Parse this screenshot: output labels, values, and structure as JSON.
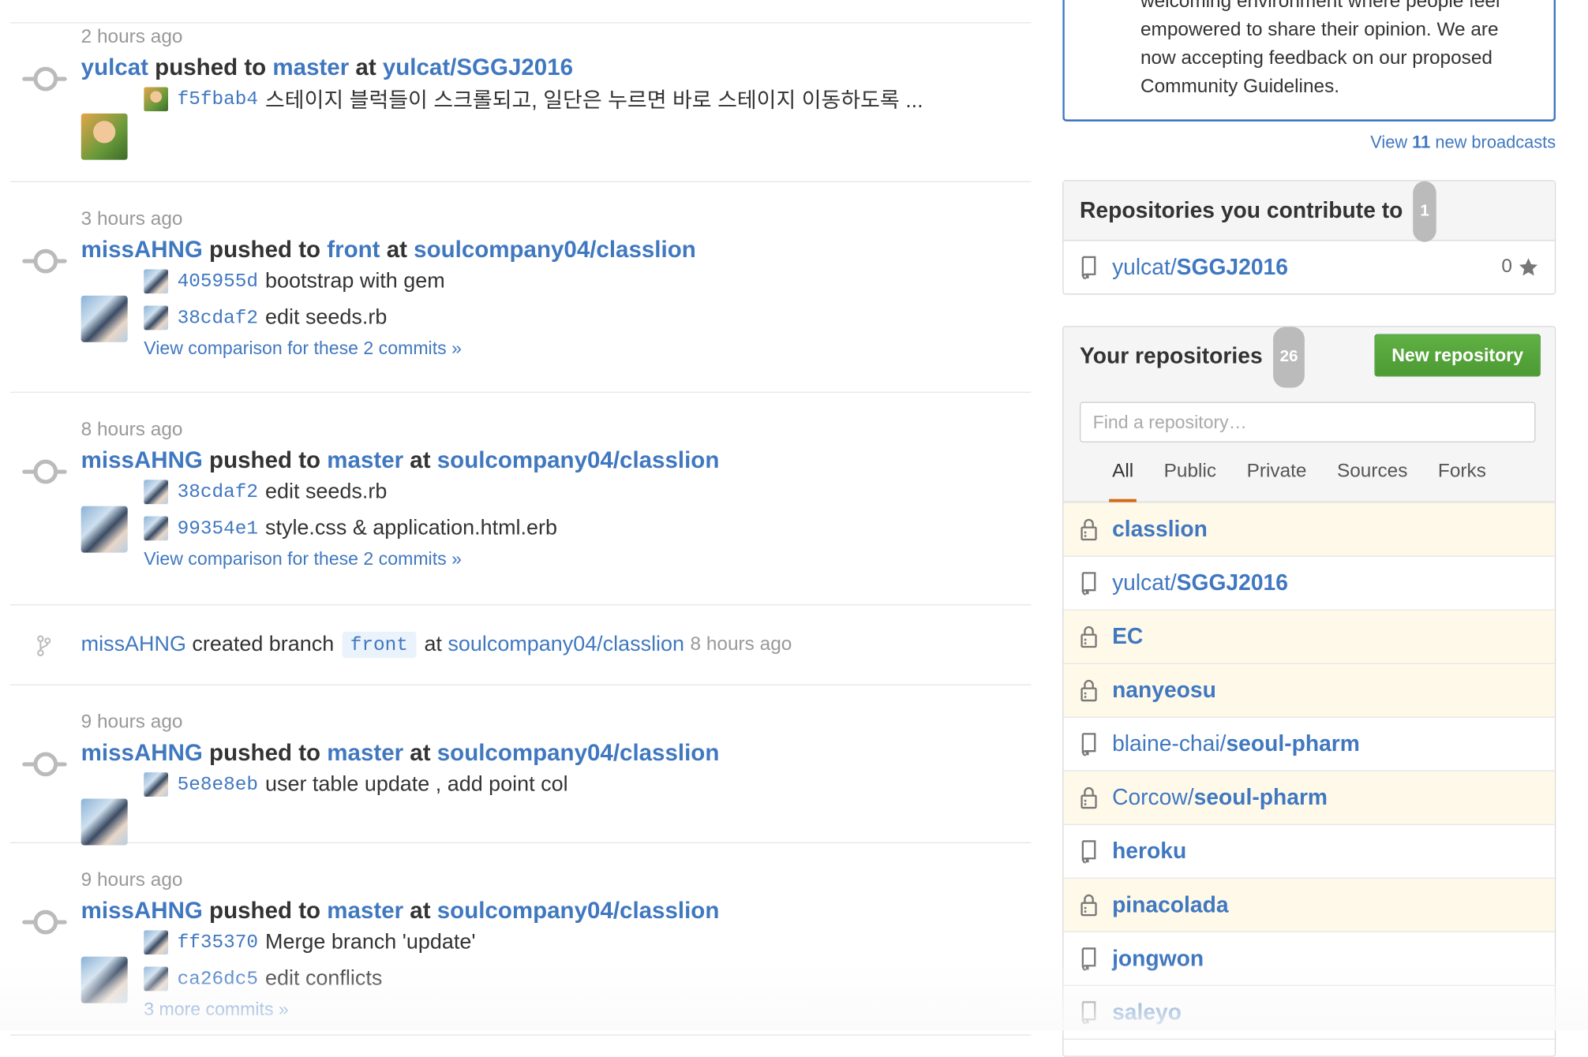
{
  "feed": {
    "events": [
      {
        "type": "push",
        "time": "2 hours ago",
        "actor": "yulcat",
        "verb": "pushed to",
        "branch": "master",
        "at": "at",
        "repo": "yulcat/SGGJ2016",
        "avatar": "girl",
        "commits": [
          {
            "sha": "f5fbab4",
            "message": "스테이지 블럭들이 스크롤되고, 일단은 누르면 바로 스테이지 이동하도록 ..."
          }
        ],
        "compare": ""
      },
      {
        "type": "push",
        "time": "3 hours ago",
        "actor": "missAHNG",
        "verb": "pushed to",
        "branch": "front",
        "at": "at",
        "repo": "soulcompany04/classlion",
        "avatar": "ahng",
        "commits": [
          {
            "sha": "405955d",
            "message": "bootstrap with gem"
          },
          {
            "sha": "38cdaf2",
            "message": "edit seeds.rb"
          }
        ],
        "compare": "View comparison for these 2 commits »"
      },
      {
        "type": "push",
        "time": "8 hours ago",
        "actor": "missAHNG",
        "verb": "pushed to",
        "branch": "master",
        "at": "at",
        "repo": "soulcompany04/classlion",
        "avatar": "ahng",
        "commits": [
          {
            "sha": "38cdaf2",
            "message": "edit seeds.rb"
          },
          {
            "sha": "99354e1",
            "message": "style.css & application.html.erb"
          }
        ],
        "compare": "View comparison for these 2 commits »"
      },
      {
        "type": "branch",
        "actor": "missAHNG",
        "verb": "created branch",
        "branch": "front",
        "at": "at",
        "repo": "soulcompany04/classlion",
        "time": "8 hours ago"
      },
      {
        "type": "push",
        "time": "9 hours ago",
        "actor": "missAHNG",
        "verb": "pushed to",
        "branch": "master",
        "at": "at",
        "repo": "soulcompany04/classlion",
        "avatar": "ahng",
        "commits": [
          {
            "sha": "5e8e8eb",
            "message": "user table update , add point col"
          }
        ],
        "compare": ""
      },
      {
        "type": "push",
        "time": "9 hours ago",
        "actor": "missAHNG",
        "verb": "pushed to",
        "branch": "master",
        "at": "at",
        "repo": "soulcompany04/classlion",
        "avatar": "ahng",
        "commits": [
          {
            "sha": "ff35370",
            "message": "Merge branch 'update'"
          },
          {
            "sha": "ca26dc5",
            "message": "edit conflicts"
          }
        ],
        "compare": "3 more commits »"
      }
    ]
  },
  "sidebar": {
    "broadcast": {
      "text": "welcoming environment where people feel empowered to share their opinion. We are now accepting feedback on our proposed Community Guidelines.",
      "view_prefix": "View",
      "view_count": "11",
      "view_suffix": "new broadcasts"
    },
    "contribute": {
      "title": "Repositories you contribute to",
      "count": "1",
      "repo_owner": "yulcat/",
      "repo_name": "SGGJ2016",
      "stars": "0"
    },
    "your_repos": {
      "title": "Your repositories",
      "count": "26",
      "new_button": "New repository",
      "filter_placeholder": "Find a repository…",
      "tabs": [
        "All",
        "Public",
        "Private",
        "Sources",
        "Forks"
      ],
      "selected_tab": "All",
      "repos": [
        {
          "owner": "",
          "name": "classlion",
          "private": true
        },
        {
          "owner": "yulcat/",
          "name": "SGGJ2016",
          "private": false
        },
        {
          "owner": "",
          "name": "EC",
          "private": true
        },
        {
          "owner": "",
          "name": "nanyeosu",
          "private": true
        },
        {
          "owner": "blaine-chai/",
          "name": "seoul-pharm",
          "private": false
        },
        {
          "owner": "Corcow/",
          "name": "seoul-pharm",
          "private": true
        },
        {
          "owner": "",
          "name": "heroku",
          "private": false
        },
        {
          "owner": "",
          "name": "pinacolada",
          "private": true
        },
        {
          "owner": "",
          "name": "jongwon",
          "private": false
        },
        {
          "owner": "",
          "name": "saleyo",
          "private": false
        }
      ]
    }
  },
  "colors": {
    "link": "#4078c0",
    "private_row": "#fff9ea",
    "new_button": "#55a532",
    "tab_underline": "#d26911"
  }
}
